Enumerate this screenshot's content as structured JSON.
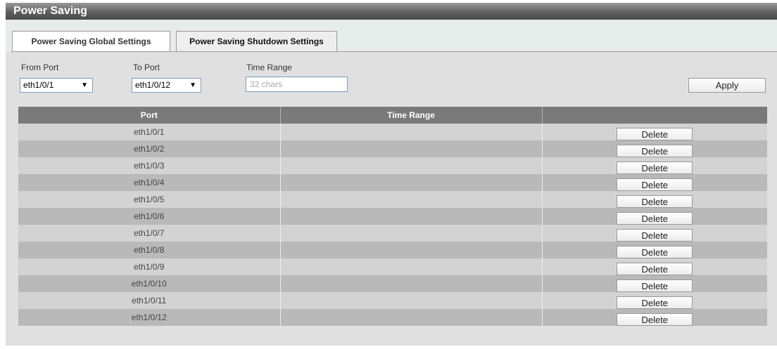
{
  "page": {
    "title": "Power Saving"
  },
  "tabs": [
    {
      "label": "Power Saving Global Settings",
      "active": false
    },
    {
      "label": "Power Saving Shutdown Settings",
      "active": true
    }
  ],
  "form": {
    "from_port_label": "From Port",
    "from_port_value": "eth1/0/1",
    "to_port_label": "To Port",
    "to_port_value": "eth1/0/12",
    "time_range_label": "Time Range",
    "time_range_placeholder": "32 chars",
    "time_range_value": "",
    "apply_label": "Apply"
  },
  "table": {
    "headers": [
      "Port",
      "Time Range",
      ""
    ],
    "delete_label": "Delete",
    "rows": [
      {
        "port": "eth1/0/1",
        "time_range": ""
      },
      {
        "port": "eth1/0/2",
        "time_range": ""
      },
      {
        "port": "eth1/0/3",
        "time_range": ""
      },
      {
        "port": "eth1/0/4",
        "time_range": ""
      },
      {
        "port": "eth1/0/5",
        "time_range": ""
      },
      {
        "port": "eth1/0/6",
        "time_range": ""
      },
      {
        "port": "eth1/0/7",
        "time_range": ""
      },
      {
        "port": "eth1/0/8",
        "time_range": ""
      },
      {
        "port": "eth1/0/9",
        "time_range": ""
      },
      {
        "port": "eth1/0/10",
        "time_range": ""
      },
      {
        "port": "eth1/0/11",
        "time_range": ""
      },
      {
        "port": "eth1/0/12",
        "time_range": ""
      }
    ]
  },
  "colors": {
    "title_bar": "#5f5f5f",
    "table_header": "#7a7a7a",
    "row_light": "#d3d3d3",
    "row_dark": "#b9b9b9",
    "input_border": "#7a9cc0"
  },
  "icons": {
    "dropdown": "triangle-down-icon"
  }
}
